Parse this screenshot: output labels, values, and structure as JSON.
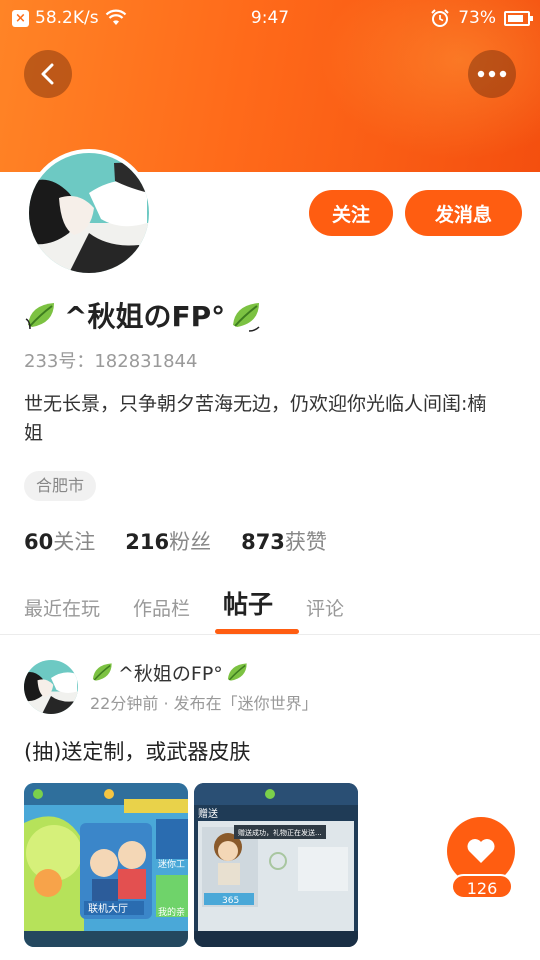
{
  "status_bar": {
    "speed": "58.2K/s",
    "time": "9:47",
    "battery": "73%"
  },
  "profile": {
    "nickname": "^秋姐のFP°",
    "id_label": "233号：182831844",
    "bio": "世无长景，只争朝夕苦海无边，仍欢迎你光临人间闺:楠姐",
    "location": "合肥市",
    "follow_button": "关注",
    "message_button": "发消息"
  },
  "stats": [
    {
      "count": "60",
      "label": "关注"
    },
    {
      "count": "216",
      "label": "粉丝"
    },
    {
      "count": "873",
      "label": "获赞"
    }
  ],
  "tabs": [
    {
      "label": "最近在玩",
      "active": false
    },
    {
      "label": "作品栏",
      "active": false
    },
    {
      "label": "帖子",
      "active": true
    },
    {
      "label": "评论",
      "active": false
    }
  ],
  "post": {
    "author": "^秋姐のFP°",
    "meta": "22分钟前 · 发布在「迷你世界」",
    "text": "(抽)送定制，或武器皮肤",
    "image1_caption": "联机大厅",
    "image1_caption2": "我的亲",
    "image1_caption3": "迷你工",
    "image2_title": "赠送",
    "image2_toast": "赠送成功，礼物正在发送...",
    "image2_price": "365",
    "like_count": "126"
  },
  "colors": {
    "accent": "#ff5d11",
    "banner": "#ff7a20"
  }
}
